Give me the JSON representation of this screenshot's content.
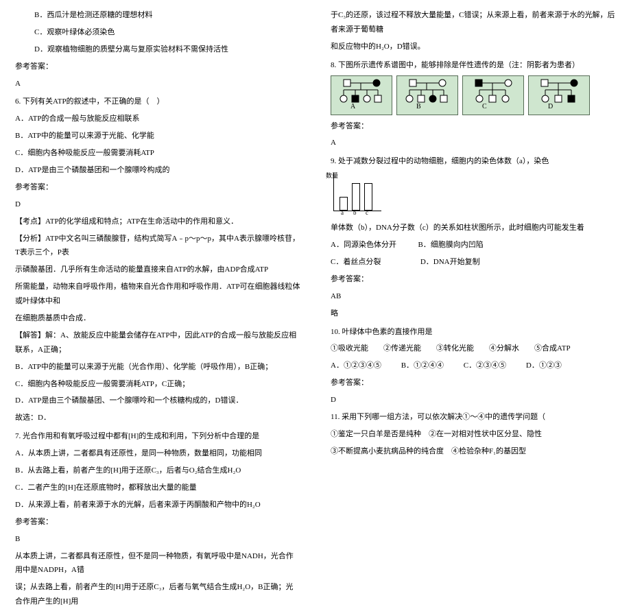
{
  "left": {
    "optB": "B．西瓜汁是检测还原糖的理想材料",
    "optC": "C．观察叶绿体必须染色",
    "optD": "D．观察植物细胞的质壁分离与复原实验材料不需保持活性",
    "ansLabel1": "参考答案：",
    "ansVal1": "A",
    "q6": "6. 下列有关ATP的叙述中，不正确的是（　）",
    "q6a": "A．ATP的合成一般与放能反应相联系",
    "q6b": "B．ATP中的能量可以来源于光能、化学能",
    "q6c": "C．细胞内各种吸能反应一般需要消耗ATP",
    "q6d": "D．ATP是由三个磷酸基团和一个腺嘌呤构成的",
    "ansLabel2": "参考答案：",
    "ansVal2": "D",
    "kd": "【考点】ATP的化学组成和特点；ATP在生命活动中的作用和意义．",
    "fx1": "【分析】ATP中文名叫三磷酸腺苷，结构式简写A﹣p～p～p，其中A表示腺嘌呤核苷，T表示三个，P表",
    "fx2": "示磷酸基团．几乎所有生命活动的能量直接来自ATP的水解，由ADP合成ATP",
    "fx3": "所需能量，动物来自呼吸作用，植物来自光合作用和呼吸作用．ATP可在细胞器线粒体或叶绿体中和",
    "fx4": "在细胞质基质中合成．",
    "jd1": "【解答】解：A、放能反应中能量会储存在ATP中，因此ATP的合成一般与放能反应相联系，A正确；",
    "jd2": "B．ATP中的能量可以来源于光能（光合作用）、化学能（呼吸作用），B正确；",
    "jd3": "C．细胞内各种吸能反应一般需要消耗ATP，C正确；",
    "jd4": "D．ATP是由三个磷酸基团、一个腺嘌呤和一个核糖构成的，D错误．",
    "jd5": "故选：D．",
    "q7": "7. 光合作用和有氧呼吸过程中都有[H]的生成和利用，下列分析中合理的是",
    "q7a": "A．从本质上讲，二者都具有还原性，是同一种物质，数量相同，功能相同",
    "q7b": "B．从去路上看，前者产生的[H]用于还原C₃，后者与O₂结合生成H₂O",
    "q7c": "C．二者产生的[H]在还原底物时，都释放出大量的能量",
    "q7d": "D．从来源上看，前者来源于水的光解，后者来源于丙酮酸和产物中的H₂O",
    "ansLabel3": "参考答案：",
    "ansVal3": "B",
    "tail1": "从本质上讲，二者都具有还原性，但不是同一种物质，有氧呼吸中是NADH，光合作用中是NADPH，A错",
    "tail2": "误；从去路上看，前者产生的[H]用于还原C₃，后者与氧气结合生成H₂O，B正确；光合作用产生的[H]用"
  },
  "right": {
    "top1": "于C₃的还原，该过程不释放大量能量，C错误；从来源上看，前者来源于水的光解，后者来源于葡萄糖",
    "top2": "和反应物中的H₂O，D错误。",
    "q8": "8. 下图所示遗传系谱图中，能够排除是伴性遗传的是（注：阴影者为患者）",
    "pedA": "A",
    "pedB": "B",
    "pedC": "C",
    "pedD": "D",
    "ansLabel4": "参考答案：",
    "ansVal4": "A",
    "q9a": "9. 处于减数分裂过程中的动物细胞，细胞内的染色体数（a），染色",
    "q9b": "单体数（b），DNA分子数（c）的关系如柱状图所示，此时细胞内可能发生着",
    "q9optA": "A．同源染色体分开",
    "q9optB": "B．细胞膜向内凹陷",
    "q9optC": "C．着丝点分裂",
    "q9optD": "D．DNA开始复制",
    "ansLabel5": "参考答案：",
    "ansVal5": "AB",
    "lue": "略",
    "q10": "10. 叶绿体中色素的直接作用是",
    "q10line": "①吸收光能　　②传递光能　　③转化光能　　④分解水　　⑤合成ATP",
    "q10a": "A．①②③④⑤",
    "q10b": "B．①②④④",
    "q10c": "C．②③④⑤",
    "q10d": "D．①②③",
    "ansLabel6": "参考答案：",
    "ansVal6": "D",
    "q11a": "11. 采用下列哪一组方法，可以依次解决①～④中的遗传学问题（　",
    "q11b": "①鉴定一只白羊是否是纯种　②在一对相对性状中区分显、隐性",
    "q11c": "③不断提高小麦抗病品种的纯合度　④检验杂种F₁的基因型",
    "axis_a": "a",
    "axis_b": "b",
    "axis_c": "c",
    "axis_y": "数量"
  },
  "chart_data": {
    "type": "bar",
    "categories": [
      "a",
      "b",
      "c"
    ],
    "values": [
      1,
      2,
      2
    ],
    "title": "",
    "xlabel": "",
    "ylabel": "数量",
    "ylim": [
      0,
      2
    ]
  }
}
